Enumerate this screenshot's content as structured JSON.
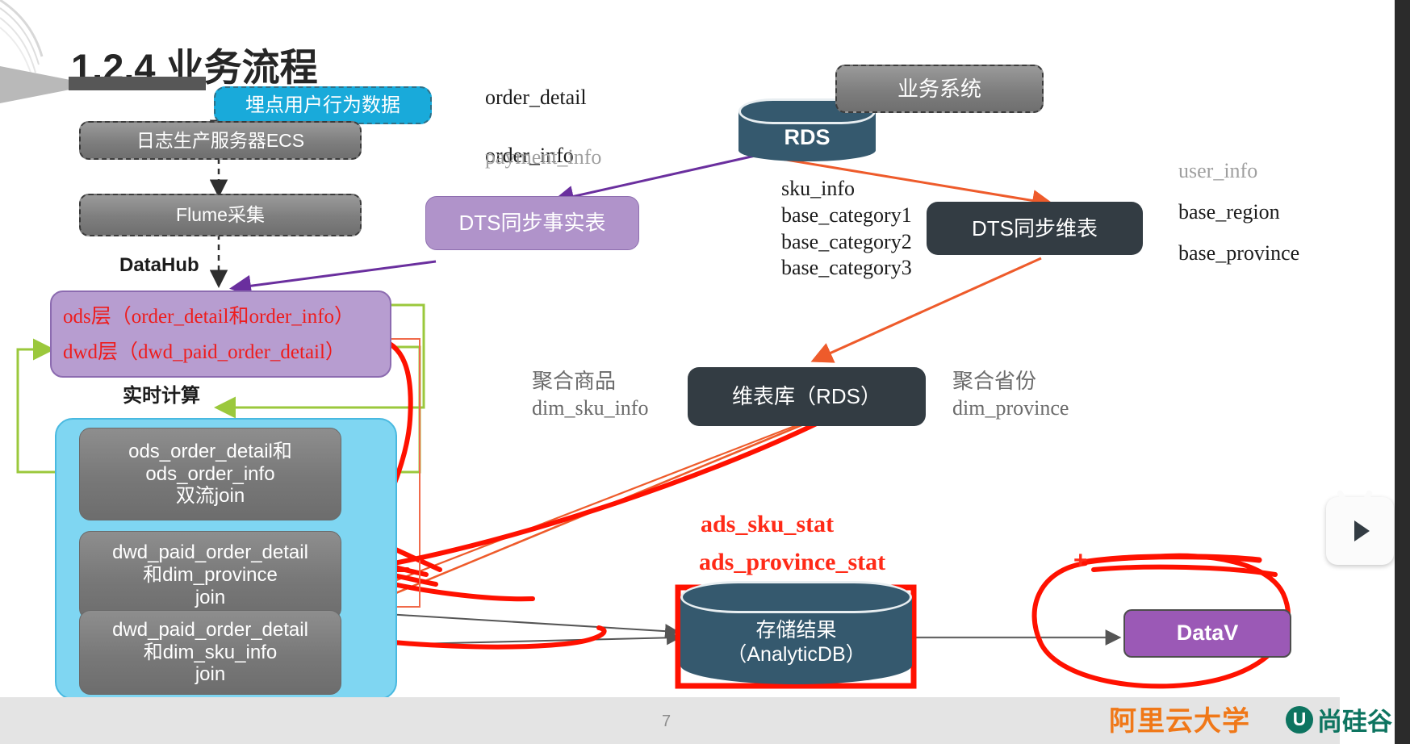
{
  "slide": {
    "title": "1.2.4 业务流程",
    "page_number": "7"
  },
  "left_flow": {
    "chip_label": "埋点用户行为数据",
    "log_server": "日志生产服务器ECS",
    "flume": "Flume采集",
    "datahub": "DataHub",
    "ods_line1": "ods层（order_detail和order_info）",
    "ods_line2": "dwd层（dwd_paid_order_detail）",
    "realtime_compute": "实时计算",
    "job1": "ods_order_detail和\nods_order_info\n双流join",
    "job2": "dwd_paid_order_detail\n和dim_province\njoin",
    "job3": "dwd_paid_order_detail\n和dim_sku_info\njoin"
  },
  "source_tables": {
    "fact_tables": "order_detail\n\norder_info",
    "fact_greyed": "payment_info",
    "dim_tables": "sku_info\nbase_category1\nbase_category2\nbase_category3",
    "dim_tables_right_greyed": "user_info",
    "dim_tables_right_1": "base_region",
    "dim_tables_right_2": "base_province"
  },
  "nodes": {
    "rds": "RDS",
    "business_system": "业务系统",
    "dts_fact": "DTS同步事实表",
    "dts_dim": "DTS同步维表",
    "dim_db": "维表库（RDS）",
    "storage_line1": "存储结果",
    "storage_line2": "（AnalyticDB）",
    "datav": "DataV"
  },
  "annotations": {
    "agg_sku_title": "聚合商品",
    "agg_sku_table": "dim_sku_info",
    "agg_province_title": "聚合省份",
    "agg_province_table": "dim_province",
    "ads_sku_stat": "ads_sku_stat",
    "ads_province_stat": "ads_province_stat",
    "ink_plus": "+"
  },
  "branding": {
    "aliyun": "阿里云大学",
    "atguigu_mark": "U",
    "atguigu_text": "尚硅谷"
  },
  "colors": {
    "cyan": "#19aada",
    "purple_node": "#b093ca",
    "dark_node": "#333c43",
    "rds_blue": "#35596e",
    "datav_purple": "#9b59b6",
    "ink_red": "#ff1100",
    "arrow_orange": "#ee5b2b",
    "arrow_purple": "#6a2f9e",
    "arrow_green": "#9bc83c",
    "brand_orange": "#f07818",
    "brand_green": "#0d7460"
  }
}
